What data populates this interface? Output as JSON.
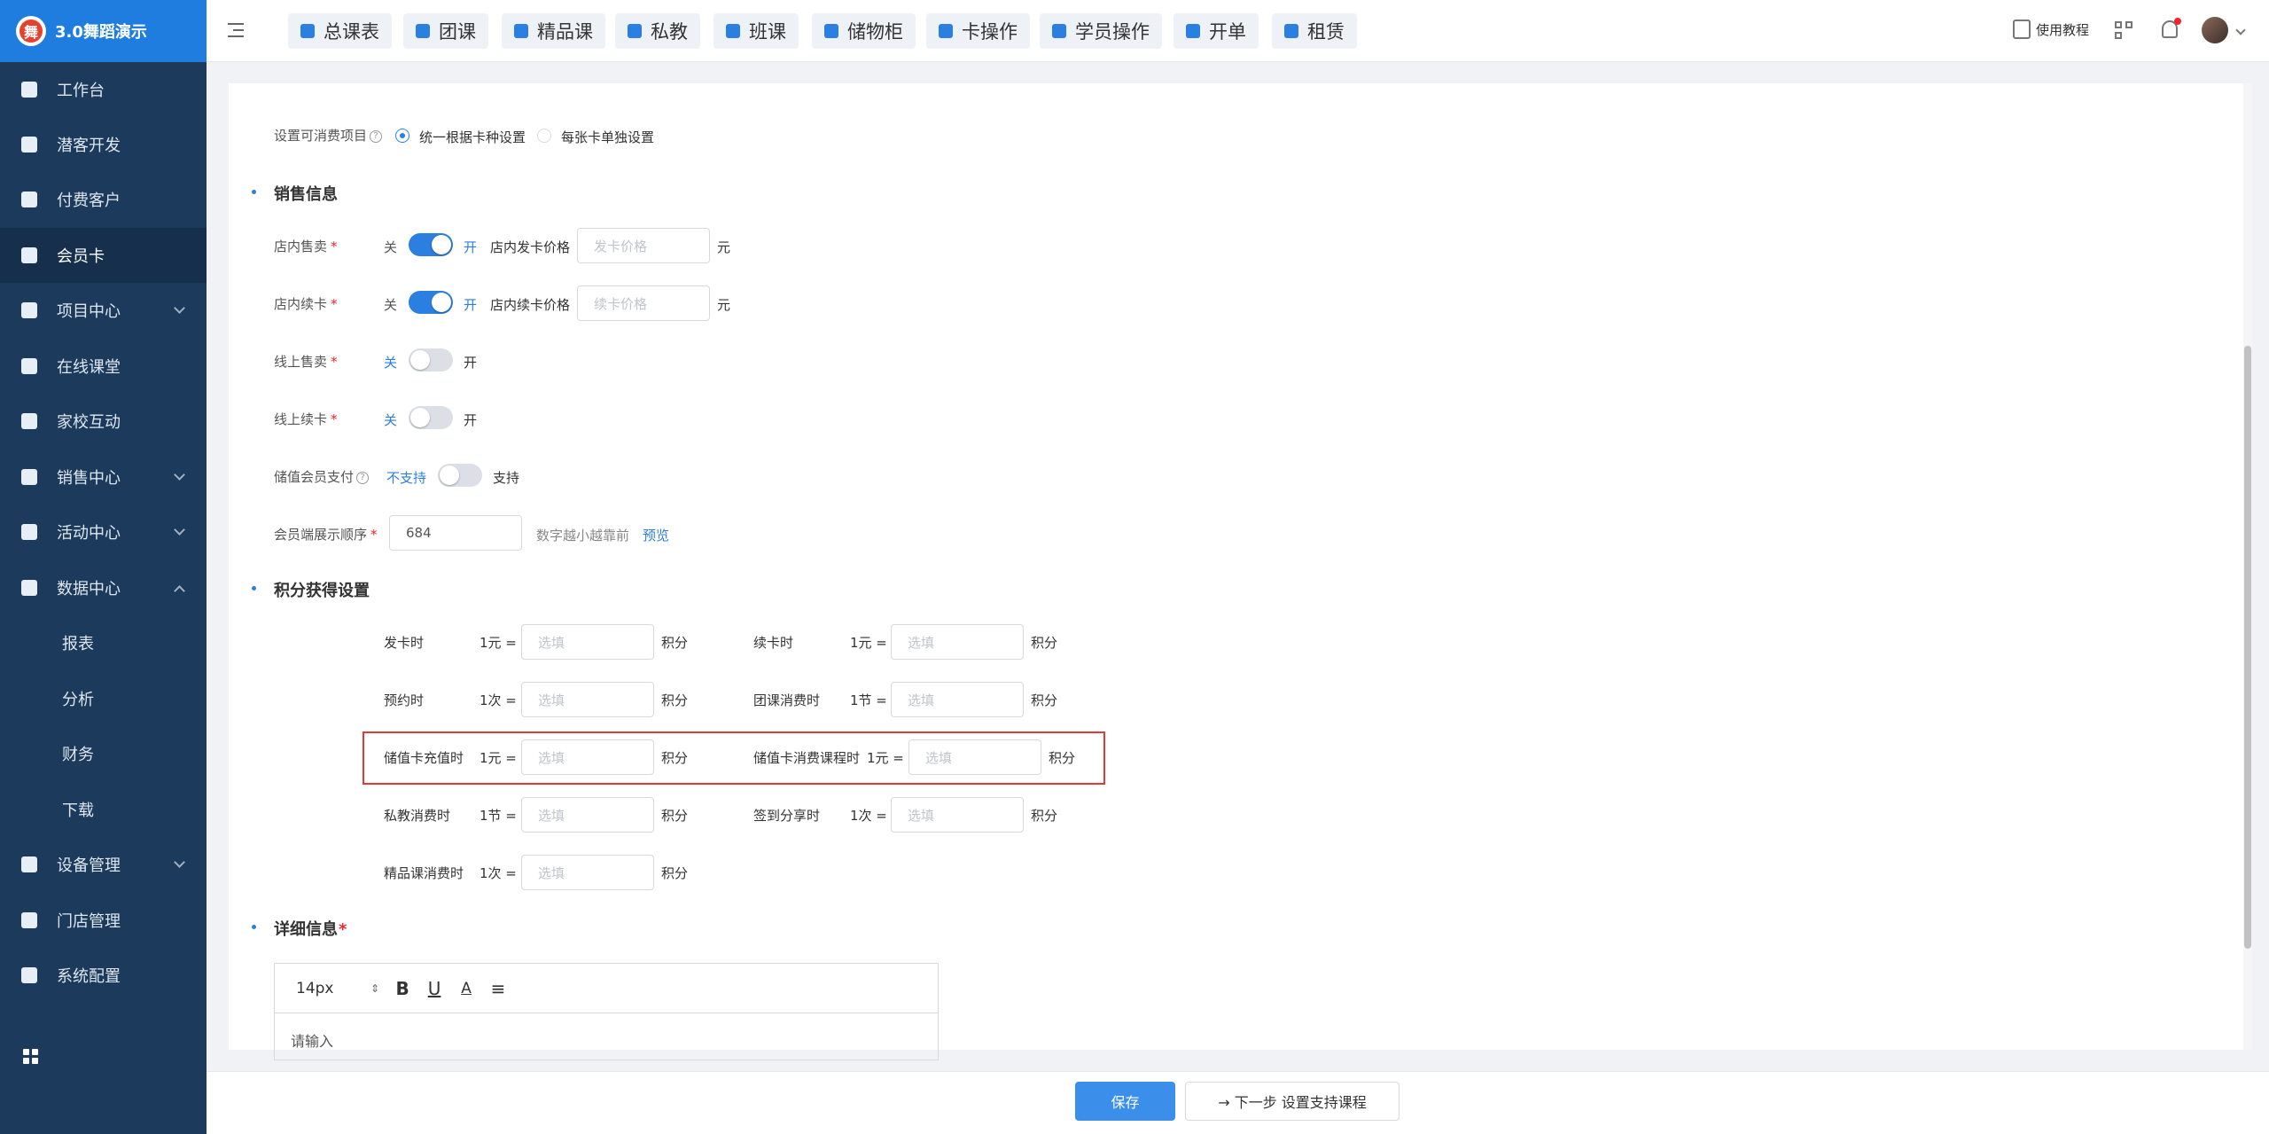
{
  "brand": {
    "name": "3.0舞蹈演示",
    "logo_char": "舞"
  },
  "sidebar": {
    "items": [
      {
        "label": "工作台",
        "icon": "image-icon"
      },
      {
        "label": "潜客开发",
        "icon": "id-card-icon"
      },
      {
        "label": "付费客户",
        "icon": "users-icon"
      },
      {
        "label": "会员卡",
        "icon": "card-icon",
        "active": true
      },
      {
        "label": "项目中心",
        "icon": "list-icon",
        "expandable": true
      },
      {
        "label": "在线课堂",
        "icon": "tv-icon"
      },
      {
        "label": "家校互动",
        "icon": "contact-icon"
      },
      {
        "label": "销售中心",
        "icon": "tag-icon",
        "expandable": true
      },
      {
        "label": "活动中心",
        "icon": "activity-icon",
        "expandable": true
      },
      {
        "label": "数据中心",
        "icon": "pie-chart-icon",
        "expandable": true,
        "expanded": true
      },
      {
        "label": "设备管理",
        "icon": "device-icon",
        "expandable": true
      },
      {
        "label": "门店管理",
        "icon": "store-icon"
      },
      {
        "label": "系统配置",
        "icon": "settings-icon"
      }
    ],
    "sub_items": [
      "报表",
      "分析",
      "财务",
      "下载"
    ]
  },
  "topbar": {
    "tabs": [
      "总课表",
      "团课",
      "精品课",
      "私教",
      "班课",
      "储物柜",
      "卡操作",
      "学员操作",
      "开单",
      "租赁"
    ],
    "tutorial": "使用教程"
  },
  "form": {
    "consume_label": "设置可消费项目",
    "consume_options": [
      "统一根据卡种设置",
      "每张卡单独设置"
    ],
    "sales_title": "销售信息",
    "store_sale": {
      "label": "店内售卖",
      "off": "关",
      "on": "开",
      "price_label": "店内发卡价格",
      "price_placeholder": "发卡价格",
      "unit": "元"
    },
    "store_renew": {
      "label": "店内续卡",
      "off": "关",
      "on": "开",
      "price_label": "店内续卡价格",
      "price_placeholder": "续卡价格",
      "unit": "元"
    },
    "online_sale": {
      "label": "线上售卖",
      "off": "关",
      "on": "开"
    },
    "online_renew": {
      "label": "线上续卡",
      "off": "关",
      "on": "开"
    },
    "stored_pay": {
      "label": "储值会员支付",
      "off": "不支持",
      "on": "支持"
    },
    "display_order": {
      "label": "会员端展示顺序",
      "value": "684",
      "hint": "数字越小越靠前",
      "preview": "预览"
    },
    "points_title": "积分获得设置",
    "points_unit": "积分",
    "placeholder": "选填",
    "points_rows": [
      {
        "left": {
          "label": "发卡时",
          "rate": "1元 ="
        },
        "right": {
          "label": "续卡时",
          "rate": "1元 ="
        }
      },
      {
        "left": {
          "label": "预约时",
          "rate": "1次 ="
        },
        "right": {
          "label": "团课消费时",
          "rate": "1节 ="
        }
      },
      {
        "left": {
          "label": "储值卡充值时",
          "rate": "1元 ="
        },
        "right": {
          "label": "储值卡消费课程时",
          "rate": "1元 ="
        }
      },
      {
        "left": {
          "label": "私教消费时",
          "rate": "1节 ="
        },
        "right": {
          "label": "签到分享时",
          "rate": "1次 ="
        }
      },
      {
        "left": {
          "label": "精品课消费时",
          "rate": "1次 ="
        }
      }
    ],
    "detail_title": "详细信息",
    "editor": {
      "font_size": "14px",
      "placeholder": "请输入"
    }
  },
  "footer": {
    "save": "保存",
    "next": "→ 下一步 设置支持课程"
  },
  "colors": {
    "primary": "#2b7fe0",
    "sidebar": "#1b3a5c",
    "highlight": "#e53935"
  }
}
